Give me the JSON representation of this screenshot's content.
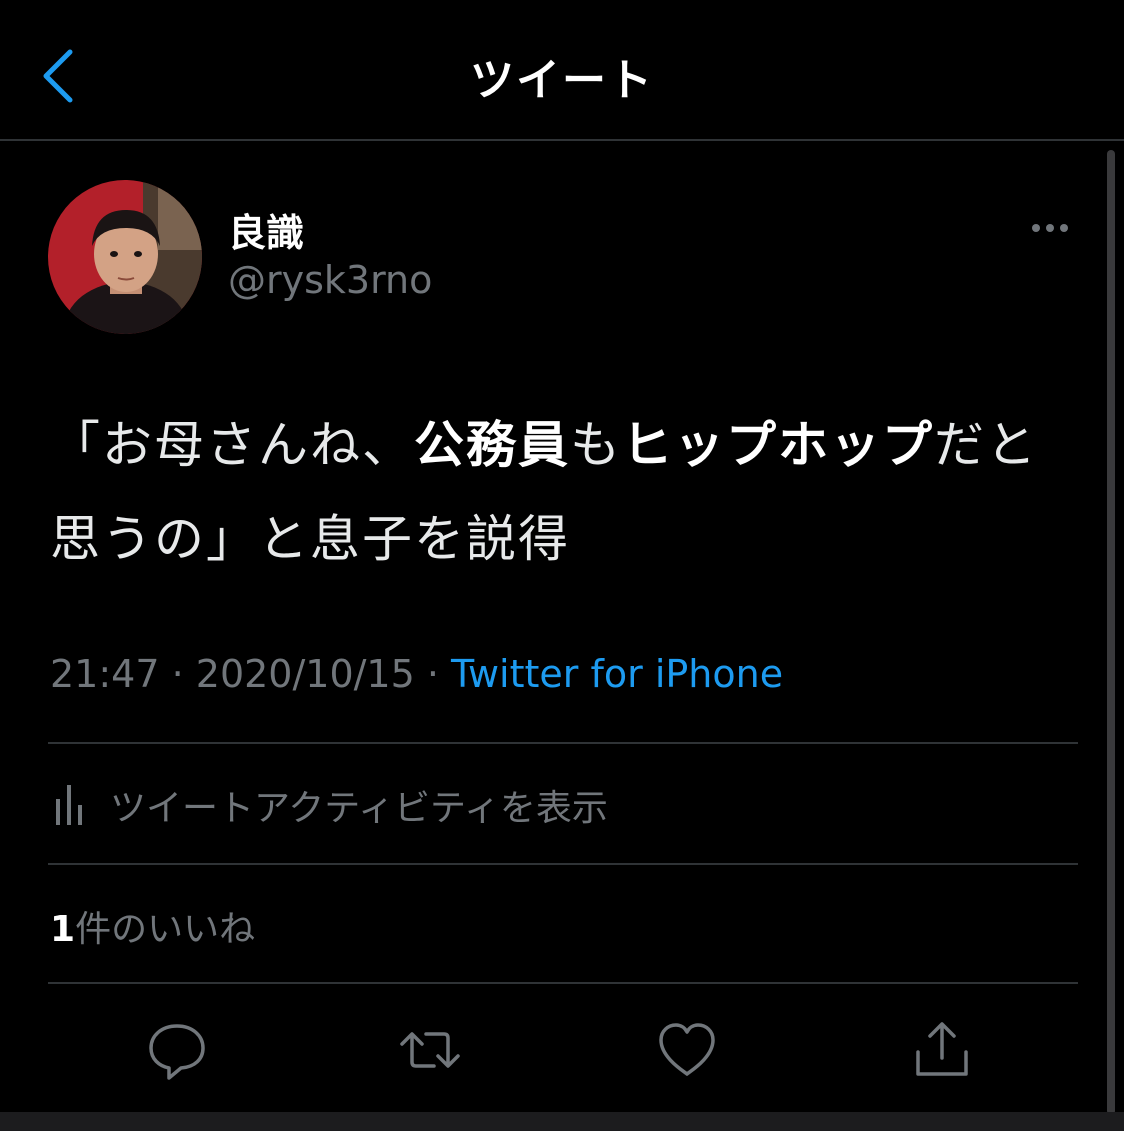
{
  "header": {
    "title": "ツイート"
  },
  "tweet": {
    "author": {
      "display_name": "良識",
      "handle": "@rysk3rno"
    },
    "text_segments": [
      "「お母さんね、",
      "公務員",
      "も",
      "ヒップホップ",
      "だと思うの」と息子を説得"
    ],
    "time": "21:47",
    "date": "2020/10/15",
    "separator": " · ",
    "source": "Twitter for iPhone",
    "activity_label": "ツイートアクティビティを表示",
    "likes": {
      "count": "1",
      "label": "件のいいね"
    }
  },
  "icons": {
    "back": "chevron-left-icon",
    "more": "more-horizontal-icon",
    "activity": "bar-chart-icon",
    "reply": "speech-bubble-icon",
    "retweet": "retweet-arrows-icon",
    "like": "heart-icon",
    "share": "share-upload-icon"
  },
  "colors": {
    "background": "#000000",
    "accent": "#1d9bf0",
    "secondary_text": "#71767b",
    "divider": "#2f3336"
  }
}
